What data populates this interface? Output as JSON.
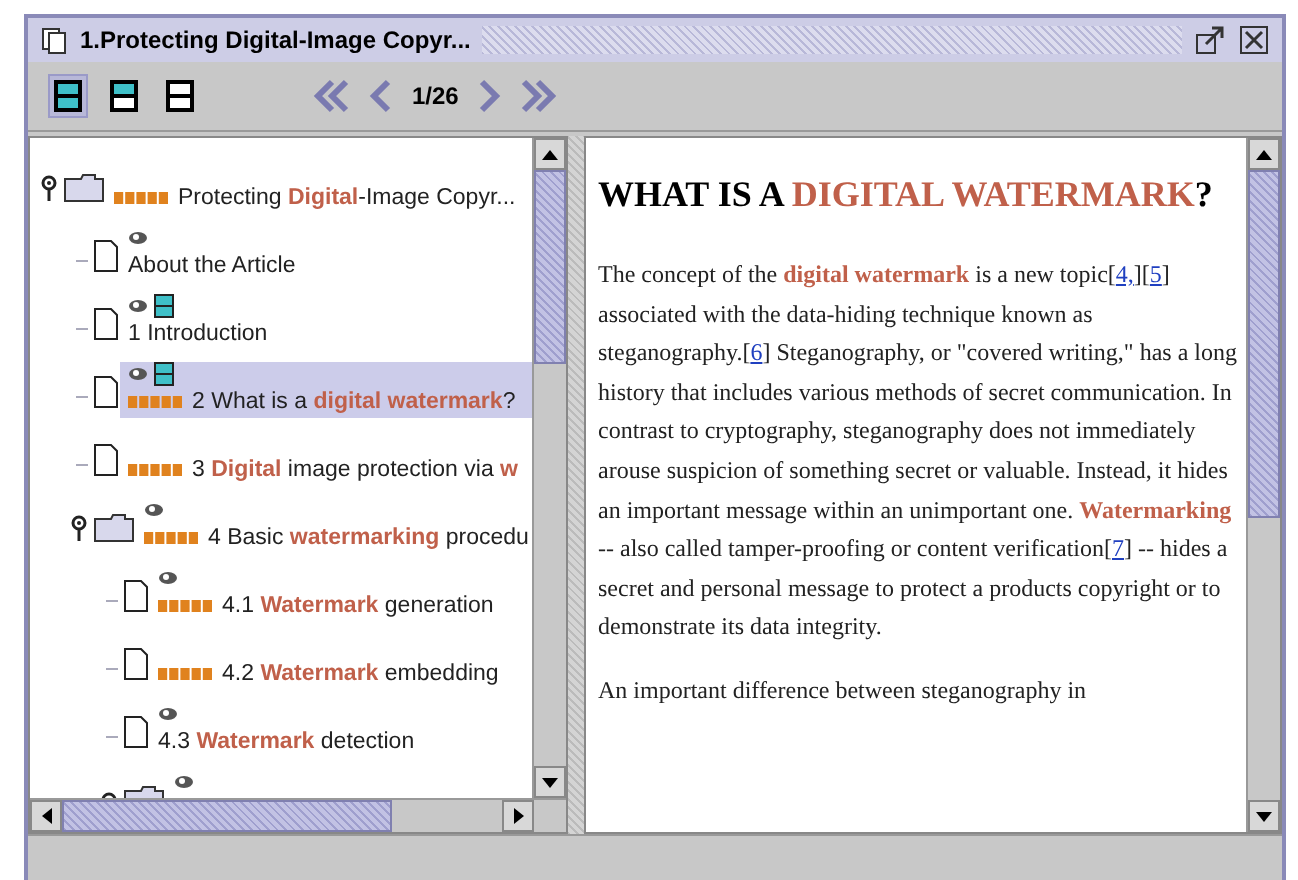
{
  "window": {
    "title": "1.Protecting Digital-Image Copyr..."
  },
  "toolbar": {
    "layouts": [
      {
        "kind": "both",
        "selected": true
      },
      {
        "kind": "top",
        "selected": false
      },
      {
        "kind": "none",
        "selected": false
      }
    ],
    "page": "1/26"
  },
  "tree": [
    {
      "kind": "folder",
      "expanded": true,
      "label": "Protecting **Digital**-Image Copyr...",
      "eye": false,
      "pane": false,
      "marker": true,
      "selected": false,
      "children": [
        {
          "kind": "page",
          "label": "About the Article",
          "eye": true,
          "pane": false,
          "marker": false,
          "selected": false
        },
        {
          "kind": "page",
          "label": "1 Introduction",
          "eye": true,
          "pane": true,
          "marker": false,
          "selected": false
        },
        {
          "kind": "page",
          "label": "2 What is a **digital watermark**?",
          "eye": true,
          "pane": true,
          "marker": true,
          "selected": true
        },
        {
          "kind": "page",
          "label": "3 **Digital** image protection via **w**",
          "eye": false,
          "pane": false,
          "marker": true,
          "selected": false
        },
        {
          "kind": "folder",
          "expanded": true,
          "label": "4 Basic **watermarking** procedu",
          "eye": true,
          "pane": false,
          "marker": true,
          "selected": false,
          "children": [
            {
              "kind": "page",
              "label": "4.1 **Watermark** generation",
              "eye": true,
              "pane": false,
              "marker": true,
              "selected": false
            },
            {
              "kind": "page",
              "label": "4.2 **Watermark** embedding",
              "eye": false,
              "pane": false,
              "marker": true,
              "selected": false
            },
            {
              "kind": "page",
              "label": "4.3 **Watermark** detection",
              "eye": true,
              "pane": false,
              "marker": false,
              "selected": false
            },
            {
              "kind": "folder",
              "expanded": false,
              "eye": true,
              "pane": false,
              "marker": false,
              "selected": false
            }
          ]
        }
      ]
    }
  ],
  "article": {
    "heading": [
      {
        "kind": "text",
        "text": "WHAT IS A "
      },
      {
        "kind": "term",
        "text": "DIGITAL WATERMARK"
      },
      {
        "kind": "text",
        "text": "?"
      }
    ],
    "paragraphs": [
      [
        {
          "kind": "text",
          "text": "The concept of the "
        },
        {
          "kind": "term",
          "text": "digital watermark"
        },
        {
          "kind": "text",
          "text": " is a new topic["
        },
        {
          "kind": "link",
          "text": "4,"
        },
        {
          "kind": "text",
          "text": "]["
        },
        {
          "kind": "link",
          "text": "5"
        },
        {
          "kind": "text",
          "text": "] associated with the data-hiding technique known as steganography.["
        },
        {
          "kind": "link",
          "text": "6"
        },
        {
          "kind": "text",
          "text": "] Steganography, or \"covered writing,\" has a long history that includes various methods of secret communication. In contrast to cryptography, steganography does not immediately arouse suspicion of something secret or valuable. Instead, it hides an important message within an unimportant one. "
        },
        {
          "kind": "term",
          "text": "Watermarking"
        },
        {
          "kind": "text",
          "text": " -- also called tamper-proofing or content verification["
        },
        {
          "kind": "link",
          "text": "7"
        },
        {
          "kind": "text",
          "text": "] -- hides a secret and personal message to protect a products copyright or to demonstrate its data integrity."
        }
      ],
      [
        {
          "kind": "text",
          "text": "An important difference between steganography in"
        }
      ]
    ]
  }
}
